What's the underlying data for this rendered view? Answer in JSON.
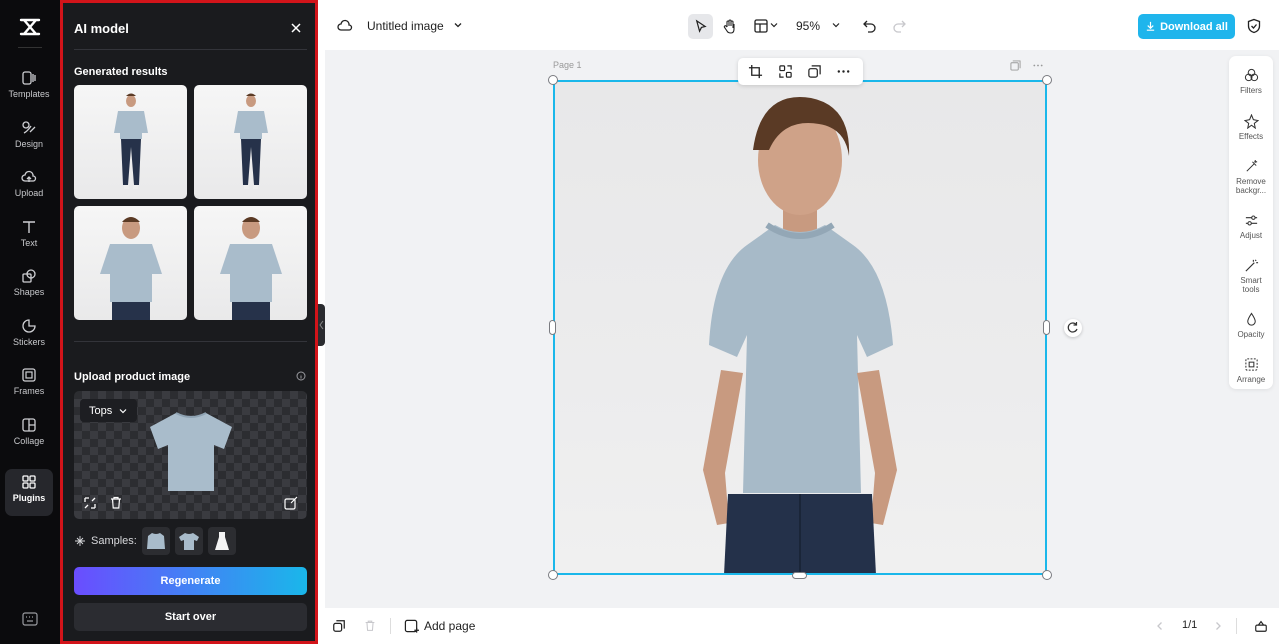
{
  "sidebar": {
    "items": [
      {
        "label": "Templates",
        "icon": "templates-icon"
      },
      {
        "label": "Design",
        "icon": "design-icon"
      },
      {
        "label": "Upload",
        "icon": "upload-cloud-icon"
      },
      {
        "label": "Text",
        "icon": "text-icon"
      },
      {
        "label": "Shapes",
        "icon": "shapes-icon"
      },
      {
        "label": "Stickers",
        "icon": "stickers-icon"
      },
      {
        "label": "Frames",
        "icon": "frames-icon"
      },
      {
        "label": "Collage",
        "icon": "collage-icon"
      },
      {
        "label": "Plugins",
        "icon": "plugins-icon",
        "active": true
      }
    ]
  },
  "panel": {
    "title": "AI model",
    "generated_heading": "Generated results",
    "upload_heading": "Upload product image",
    "category": "Tops",
    "samples_label": "Samples:",
    "regenerate_label": "Regenerate",
    "start_over_label": "Start over",
    "accent": "#d2141a"
  },
  "topbar": {
    "doc_title": "Untitled image",
    "zoom": "95%",
    "download_label": "Download all",
    "download_color": "#1fb5ec"
  },
  "canvas": {
    "page_label": "Page 1",
    "selection_color": "#1ab7ea"
  },
  "right_tools": [
    {
      "label": "Filters",
      "icon": "filters-icon"
    },
    {
      "label": "Effects",
      "icon": "effects-icon"
    },
    {
      "label": "Remove backgr...",
      "icon": "remove-background-icon"
    },
    {
      "label": "Adjust",
      "icon": "adjust-icon"
    },
    {
      "label": "Smart tools",
      "icon": "smart-tools-icon"
    },
    {
      "label": "Opacity",
      "icon": "opacity-icon"
    },
    {
      "label": "Arrange",
      "icon": "arrange-icon"
    }
  ],
  "bottombar": {
    "add_page_label": "Add page",
    "page_counter": "1/1"
  }
}
